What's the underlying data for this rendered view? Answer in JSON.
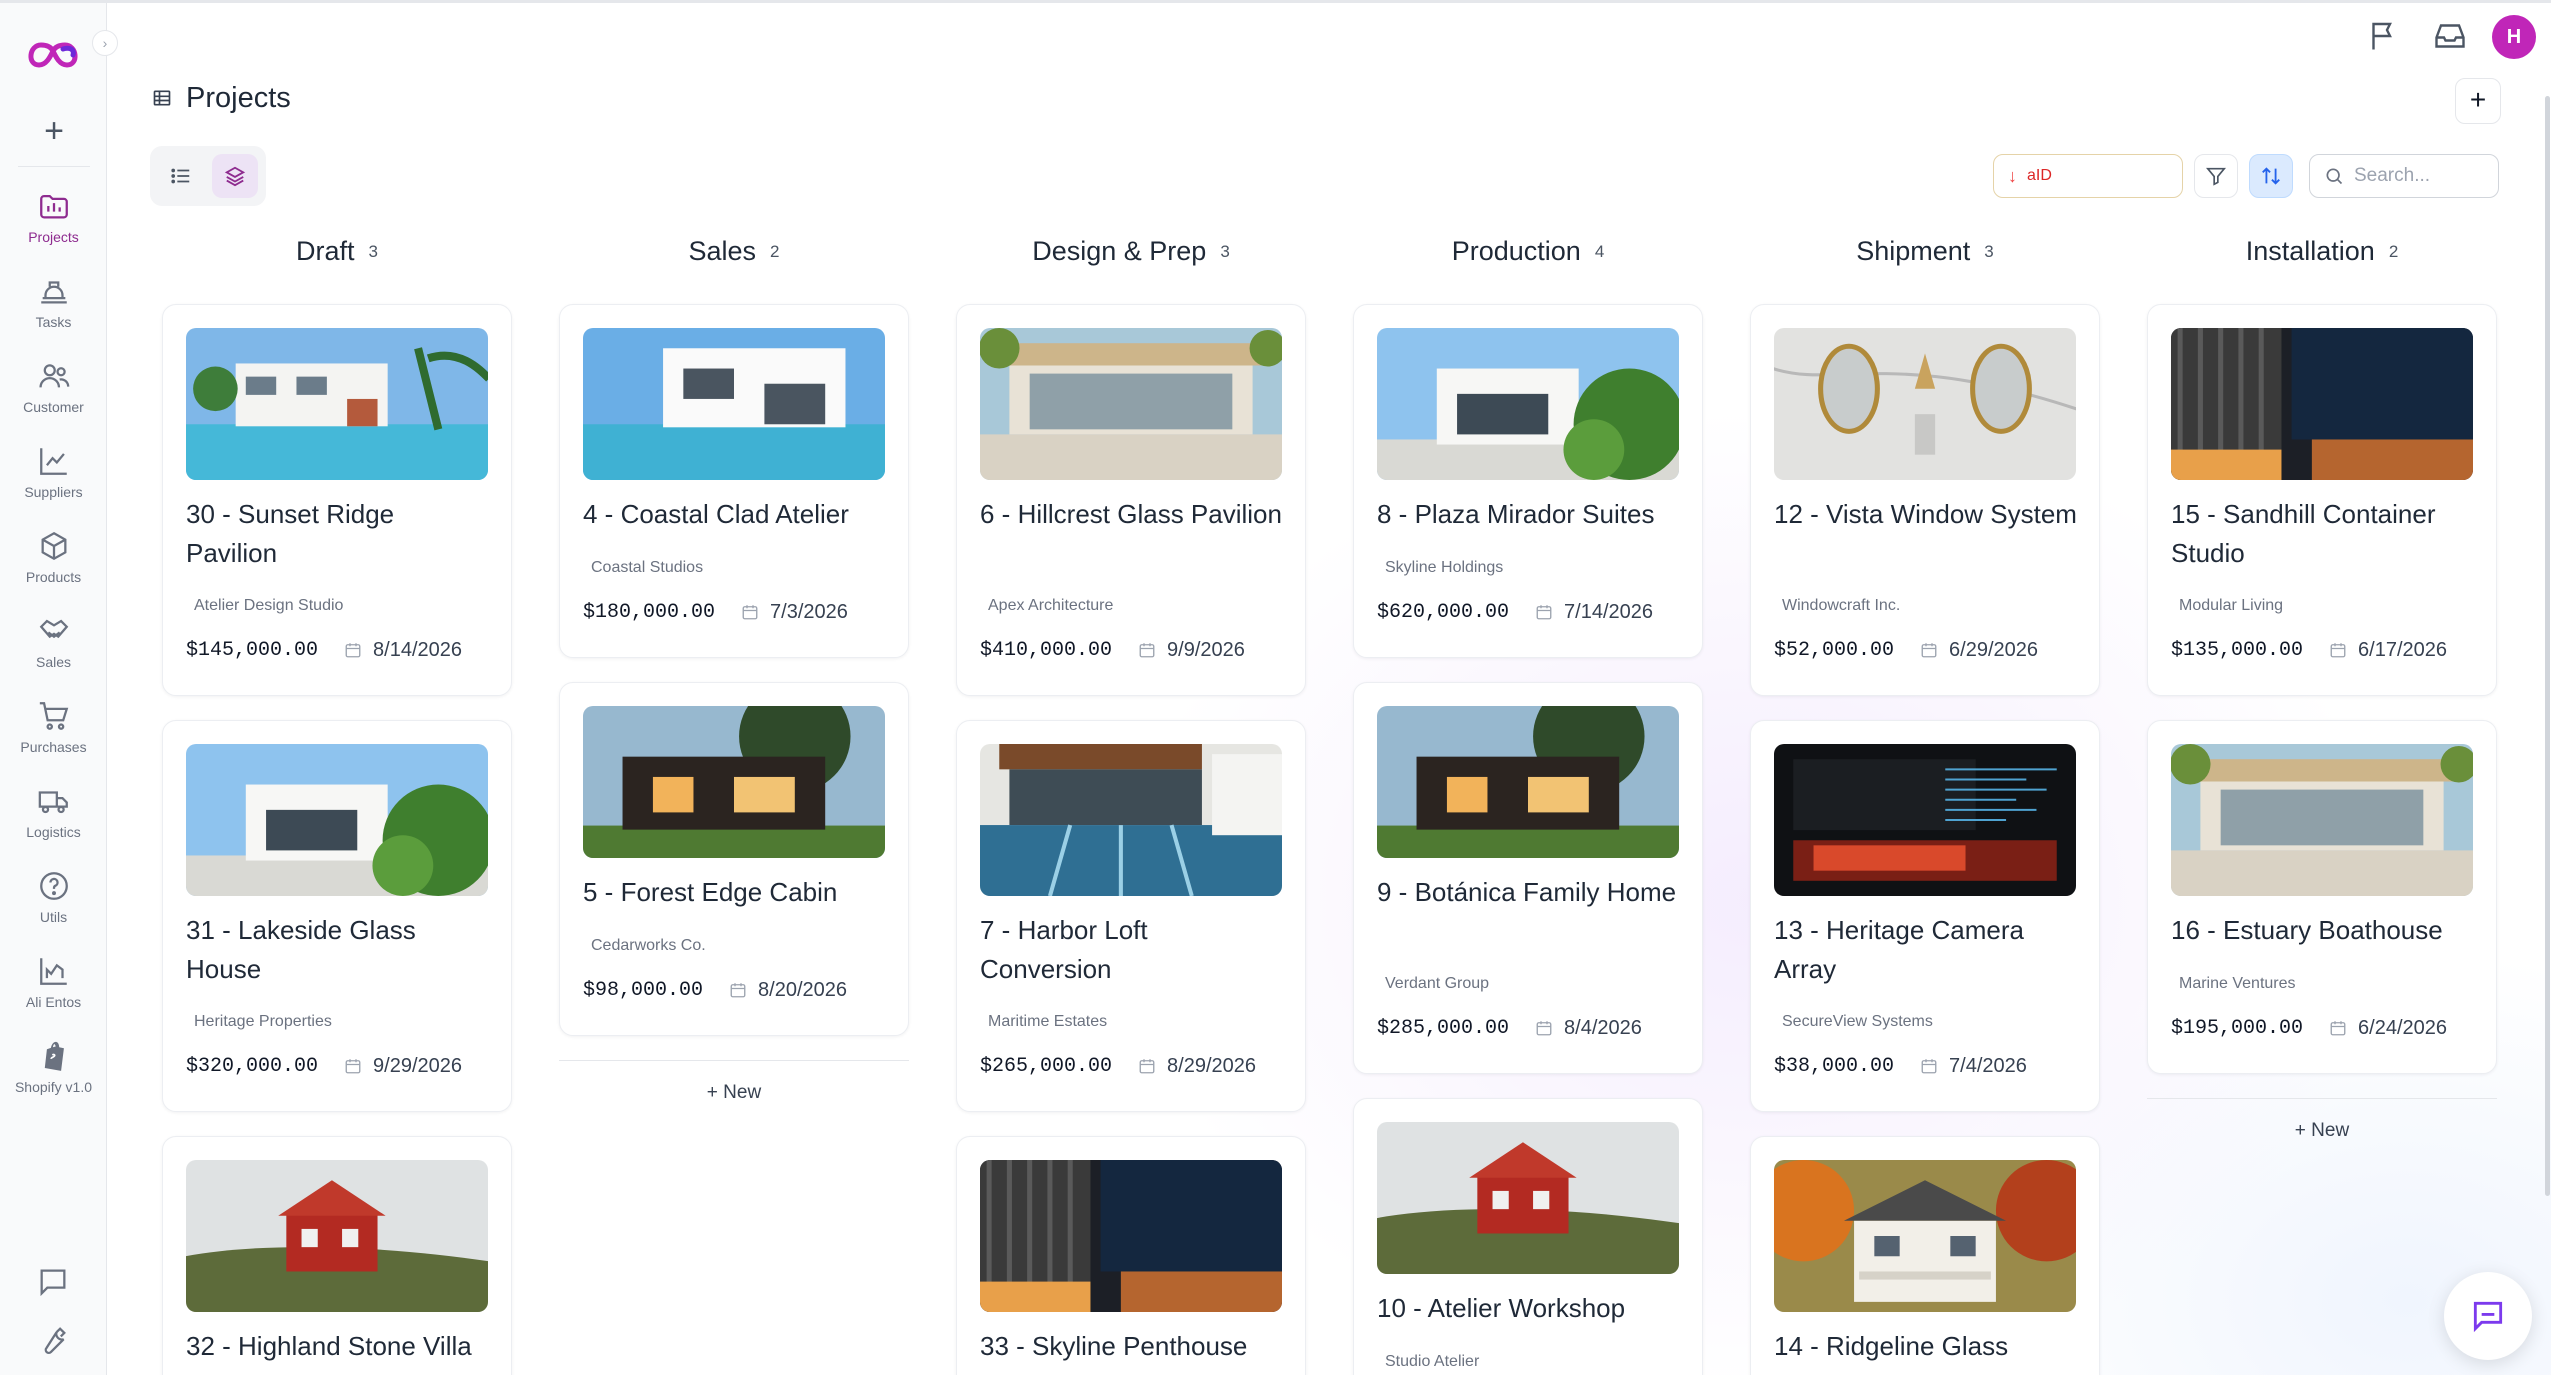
{
  "app": {
    "page_title": "Projects",
    "avatar_initial": "H",
    "brand_color": "#8e2b8f"
  },
  "sidebar": {
    "items": [
      {
        "label": "Projects",
        "icon": "projects-icon",
        "active": true
      },
      {
        "label": "Tasks",
        "icon": "tasks-icon"
      },
      {
        "label": "Customer",
        "icon": "customer-icon"
      },
      {
        "label": "Suppliers",
        "icon": "suppliers-icon"
      },
      {
        "label": "Products",
        "icon": "products-icon"
      },
      {
        "label": "Sales",
        "icon": "sales-icon"
      },
      {
        "label": "Purchases",
        "icon": "purchases-icon"
      },
      {
        "label": "Logistics",
        "icon": "logistics-icon"
      },
      {
        "label": "Utils",
        "icon": "utils-icon"
      },
      {
        "label": "Ali Entos",
        "icon": "ali-entos-icon"
      },
      {
        "label": "Shopify v1.0",
        "icon": "shopify-icon"
      }
    ]
  },
  "toolbar": {
    "sort_label": "aID",
    "search_placeholder": "Search..."
  },
  "board": {
    "add_new_label": "+ New",
    "columns": [
      {
        "title": "Draft",
        "count": "3",
        "cards": [
          {
            "title": "30 - Sunset Ridge Pavilion",
            "client": "Atelier Design Studio",
            "price": "$145,000.00",
            "date": "8/14/2026",
            "image": "villa-pool"
          },
          {
            "title": "31 - Lakeside Glass House",
            "client": "Heritage Properties",
            "price": "$320,000.00",
            "date": "9/29/2026",
            "image": "white-house-plants"
          },
          {
            "title": "32 - Highland Stone Villa",
            "client": "",
            "price": "",
            "date": "",
            "image": "red-cabin"
          }
        ]
      },
      {
        "title": "Sales",
        "count": "2",
        "cards": [
          {
            "title": "4 - Coastal Clad Atelier",
            "client": "Coastal Studios",
            "price": "$180,000.00",
            "date": "7/3/2026",
            "image": "modern-pool"
          },
          {
            "title": "5 - Forest Edge Cabin",
            "client": "Cedarworks Co.",
            "price": "$98,000.00",
            "date": "8/20/2026",
            "image": "dark-house-tree"
          }
        ]
      },
      {
        "title": "Design & Prep",
        "count": "3",
        "cards": [
          {
            "title": "6 - Hillcrest Glass Pavilion",
            "client": "Apex Architecture",
            "price": "$410,000.00",
            "date": "9/9/2026",
            "image": "glass-pavilion"
          },
          {
            "title": "7 - Harbor Loft Conversion",
            "client": "Maritime Estates",
            "price": "$265,000.00",
            "date": "8/29/2026",
            "image": "lap-pool"
          },
          {
            "title": "33 - Skyline Penthouse",
            "client": "",
            "price": "",
            "date": "",
            "image": "dark-facade"
          }
        ]
      },
      {
        "title": "Production",
        "count": "4",
        "cards": [
          {
            "title": "8 - Plaza Mirador Suites",
            "client": "Skyline Holdings",
            "price": "$620,000.00",
            "date": "7/14/2026",
            "image": "white-house-plants"
          },
          {
            "title": "9 - Botánica Family Home",
            "client": "Verdant Group",
            "price": "$285,000.00",
            "date": "8/4/2026",
            "image": "dark-house-tree"
          },
          {
            "title": "10 - Atelier Workshop",
            "client": "Studio Atelier",
            "price": "",
            "date": "",
            "image": "red-cabin"
          }
        ]
      },
      {
        "title": "Shipment",
        "count": "3",
        "cards": [
          {
            "title": "12 - Vista Window System",
            "client": "Windowcraft Inc.",
            "price": "$52,000.00",
            "date": "6/29/2026",
            "image": "mirrors"
          },
          {
            "title": "13 - Heritage Camera Array",
            "client": "SecureView Systems",
            "price": "$38,000.00",
            "date": "7/4/2026",
            "image": "dark-screen"
          },
          {
            "title": "14 - Ridgeline Glass",
            "client": "",
            "price": "",
            "date": "",
            "image": "autumn-house"
          }
        ]
      },
      {
        "title": "Installation",
        "count": "2",
        "cards": [
          {
            "title": "15 - Sandhill Container Studio",
            "client": "Modular Living",
            "price": "$135,000.00",
            "date": "6/17/2026",
            "image": "dark-facade"
          },
          {
            "title": "16 - Estuary Boathouse",
            "client": "Marine Ventures",
            "price": "$195,000.00",
            "date": "6/24/2026",
            "image": "glass-pavilion"
          }
        ]
      }
    ]
  }
}
